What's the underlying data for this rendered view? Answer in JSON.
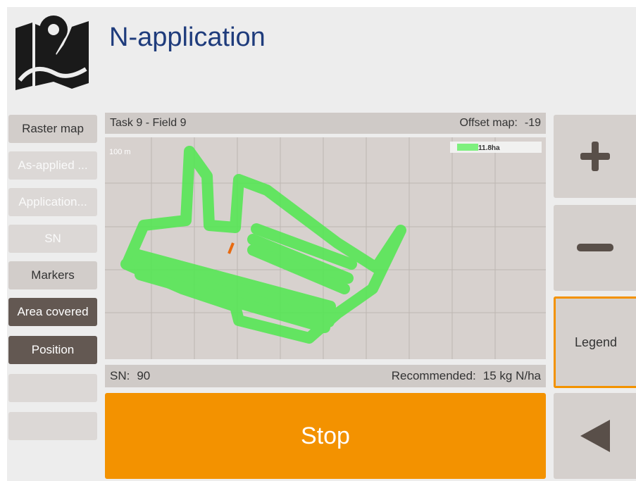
{
  "header": {
    "title": "N-application",
    "logo_icon": "map-marker-icon"
  },
  "left_buttons": [
    {
      "label": "Raster map",
      "state": "normal"
    },
    {
      "label": "As-applied ...",
      "state": "disabled"
    },
    {
      "label": "Application...",
      "state": "disabled"
    },
    {
      "label": "SN",
      "state": "disabled"
    },
    {
      "label": "Markers",
      "state": "normal"
    },
    {
      "label": "Area covered",
      "state": "active"
    },
    {
      "label": "Position",
      "state": "active"
    },
    {
      "label": "",
      "state": "empty"
    },
    {
      "label": "",
      "state": "empty"
    }
  ],
  "info_top": {
    "task": "Task 9 - Field 9",
    "offset_label": "Offset map:",
    "offset_value": "-19"
  },
  "map": {
    "scale_label": "100 m",
    "legend_area": "11.8ha",
    "coverage_color": "#4fe84f"
  },
  "info_bottom": {
    "sn_label": "SN:",
    "sn_value": "90",
    "rec_label": "Recommended:",
    "rec_value": "15 kg N/ha"
  },
  "stop_label": "Stop",
  "right_buttons": {
    "zoom_in_icon": "plus-icon",
    "zoom_out_icon": "minus-icon",
    "legend_label": "Legend",
    "back_icon": "back-arrow-icon"
  },
  "colors": {
    "accent": "#f39200",
    "title": "#1f3c7c",
    "active_button": "#635852"
  }
}
